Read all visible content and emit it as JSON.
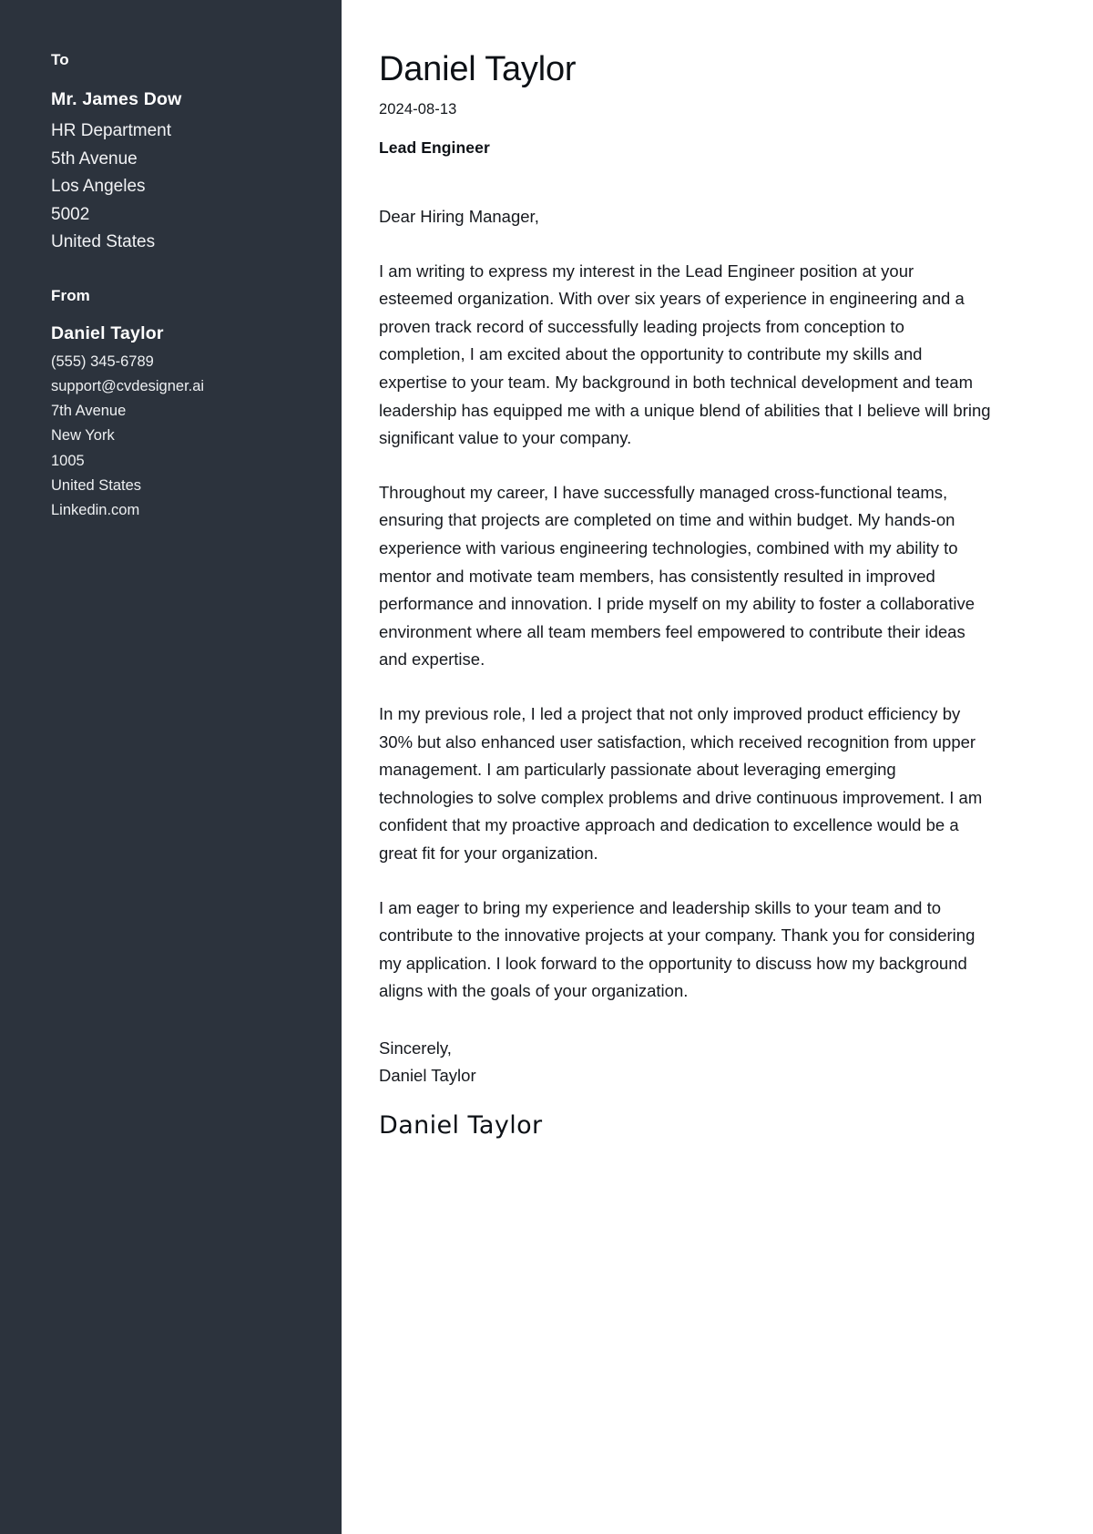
{
  "sidebar": {
    "to": {
      "label": "To",
      "name": "Mr. James Dow",
      "lines": [
        "HR Department",
        "5th Avenue",
        "Los Angeles",
        "5002",
        "United States"
      ]
    },
    "from": {
      "label": "From",
      "name": "Daniel Taylor",
      "lines": [
        "(555) 345-6789",
        "support@cvdesigner.ai",
        "7th Avenue",
        "New York",
        "1005",
        "United States",
        "Linkedin.com"
      ]
    }
  },
  "letter": {
    "name": "Daniel Taylor",
    "date": "2024-08-13",
    "position": "Lead Engineer",
    "salutation": "Dear Hiring Manager,",
    "paragraphs": [
      "I am writing to express my interest in the Lead Engineer position at your esteemed organization. With over six years of experience in engineering and a proven track record of successfully leading projects from conception to completion, I am excited about the opportunity to contribute my skills and expertise to your team. My background in both technical development and team leadership has equipped me with a unique blend of abilities that I believe will bring significant value to your company.",
      "Throughout my career, I have successfully managed cross-functional teams, ensuring that projects are completed on time and within budget. My hands-on experience with various engineering technologies, combined with my ability to mentor and motivate team members, has consistently resulted in improved performance and innovation. I pride myself on my ability to foster a collaborative environment where all team members feel empowered to contribute their ideas and expertise.",
      "In my previous role, I led a project that not only improved product efficiency by 30% but also enhanced user satisfaction, which received recognition from upper management. I am particularly passionate about leveraging emerging technologies to solve complex problems and drive continuous improvement. I am confident that my proactive approach and dedication to excellence would be a great fit for your organization.",
      "I am eager to bring my experience and leadership skills to your team and to contribute to the innovative projects at your company. Thank you for considering my application. I look forward to the opportunity to discuss how my background aligns with the goals of your organization."
    ],
    "closing_word": "Sincerely,",
    "closing_name": "Daniel Taylor",
    "signature": "Daniel Taylor"
  },
  "colors": {
    "sidebar_bg": "#2c333d",
    "sidebar_text": "#ffffff",
    "content_bg": "#ffffff",
    "content_text": "#16191e"
  }
}
